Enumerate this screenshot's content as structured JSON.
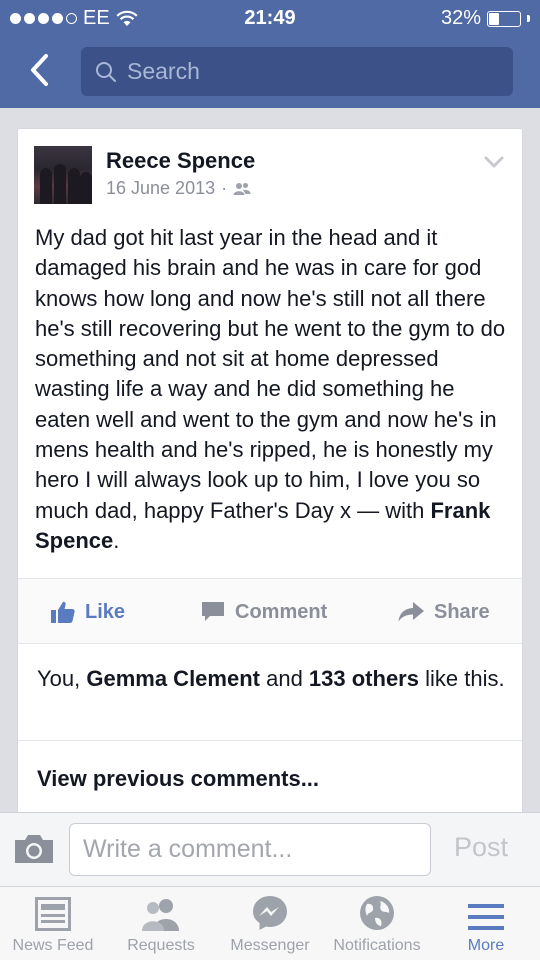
{
  "status_bar": {
    "carrier": "EE",
    "time": "21:49",
    "battery": "32%",
    "battery_level": 0.32
  },
  "header": {
    "search_placeholder": "Search"
  },
  "post": {
    "author": "Reece Spence",
    "date": "16 June 2013",
    "separator": "·",
    "text": "My dad got hit last year in the head and it damaged his brain and he was in care for god knows how long and now he's still not all there he's still recovering but he went to the gym to do something and not sit at home depressed wasting life a way and he did something he eaten well and went to the gym and now he's in mens health and he's ripped, he is honestly my hero I will always look up to him, I love you so much dad, happy Father's Day x — with ",
    "tagged": "Frank Spence",
    "end_punct": ".",
    "actions": {
      "like": "Like",
      "comment": "Comment",
      "share": "Share"
    },
    "likes": {
      "prefix": "You, ",
      "name": "Gemma Clement",
      "middle": " and ",
      "others": "133 others",
      "suffix": " like this."
    },
    "view_previous": "View previous comments..."
  },
  "comment_bar": {
    "placeholder": "Write a comment...",
    "post_label": "Post"
  },
  "tabs": [
    {
      "label": "News Feed",
      "icon": "news-feed-icon"
    },
    {
      "label": "Requests",
      "icon": "friend-requests-icon"
    },
    {
      "label": "Messenger",
      "icon": "messenger-icon"
    },
    {
      "label": "Notifications",
      "icon": "notifications-globe-icon"
    },
    {
      "label": "More",
      "icon": "more-menu-icon",
      "active": true
    }
  ],
  "colors": {
    "brand_blue": "#4f6aa5",
    "search_bg": "#3b5187",
    "link_blue": "#5b7bc0",
    "muted": "#8b8f99"
  }
}
